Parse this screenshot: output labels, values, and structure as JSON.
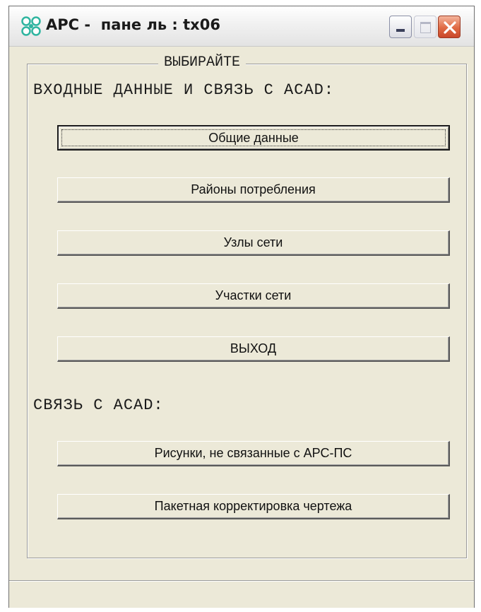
{
  "window": {
    "title": "APC -  пане ль : tx06"
  },
  "group": {
    "legend": "ВЫБИРАЙТЕ"
  },
  "section1": {
    "label": "ВХОДНЫЕ ДАННЫЕ И СВЯЗЬ С ACAD:",
    "buttons": [
      {
        "label": "Общие данные"
      },
      {
        "label": "Районы потребления"
      },
      {
        "label": "Узлы сети"
      },
      {
        "label": "Участки сети"
      },
      {
        "label": "ВЫХОД"
      }
    ]
  },
  "section2": {
    "label": "СВЯЗЬ С ACAD:",
    "buttons": [
      {
        "label": "Рисунки, не связанные с АРС-ПС"
      },
      {
        "label": "Пакетная корректировка чертежа"
      }
    ]
  },
  "statusbar": {
    "text": ""
  },
  "colors": {
    "window_bg": "#ece9d8",
    "close_button": "#e06a44",
    "app_icon": "#2fb5a0"
  },
  "icons": {
    "app": "app-icon",
    "minimize": "minimize-icon",
    "maximize": "maximize-icon",
    "close": "close-icon"
  }
}
